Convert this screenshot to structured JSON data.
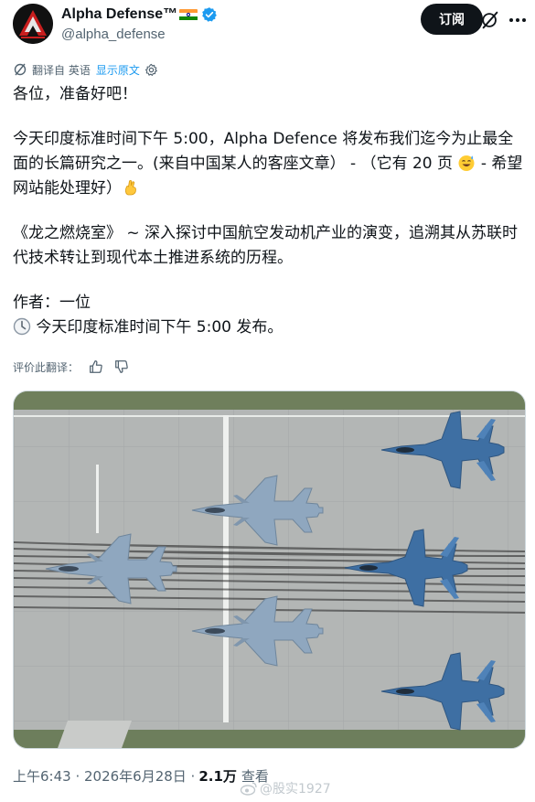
{
  "author": {
    "display_name": "Alpha Defense™",
    "handle": "@alpha_defense",
    "flag_icon": "india-flag-icon",
    "verified_icon": "verified-badge-icon",
    "verified_color": "#1d9bf0"
  },
  "actions": {
    "subscribe_label": "订阅",
    "grok_icon": "grok-icon",
    "more_icon": "more-icon"
  },
  "translation": {
    "translated_from": "翻译自 英语",
    "show_original": "显示原文"
  },
  "post": {
    "line1": "各位，准备好吧！",
    "line2a": "今天印度标准时间下午 5:00，Alpha Defence 将发布我们迄今为止最全面的长篇研究之一。(来自中国某人的客座文章） - （它有 20 页 ",
    "line2b": " - 希望网站能处理好）",
    "line3": "《龙之燃烧室》 ~ 深入探讨中国航空发动机产业的演变，追溯其从苏联时代技术转让到现代本土推进系统的历程。",
    "line4": "作者：一位",
    "line5": " 今天印度标准时间下午 5:00 发布。"
  },
  "rate_translation": {
    "label": "评价此翻译："
  },
  "meta": {
    "timestamp": "上午6:43 · 2026年6月28日 · ",
    "views": "2.1万",
    "views_label": "查看"
  },
  "watermark": {
    "text": "@股实1927"
  },
  "colors": {
    "link": "#1d9bf0",
    "secondary_text": "#536471",
    "button_dark": "#0f1419"
  }
}
